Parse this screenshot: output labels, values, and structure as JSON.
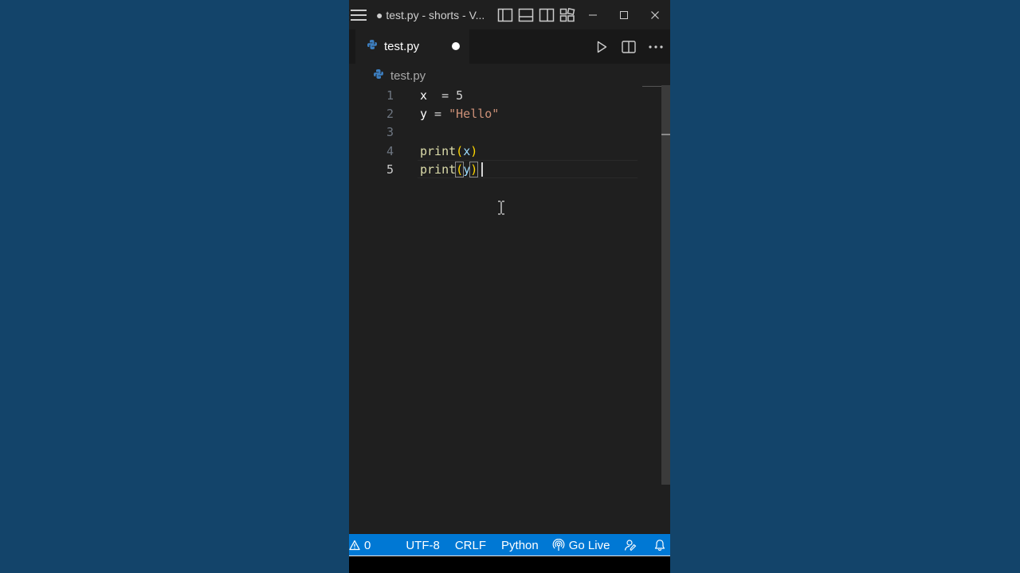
{
  "window": {
    "title": "● test.py - shorts - V..."
  },
  "tabs": [
    {
      "label": "test.py",
      "dirty": true
    }
  ],
  "breadcrumb": {
    "file": "test.py"
  },
  "editor": {
    "lines": [
      {
        "number": "1",
        "text": "x  = 5"
      },
      {
        "number": "2",
        "text": "y = \"Hello\""
      },
      {
        "number": "3",
        "text": ""
      },
      {
        "number": "4",
        "text": "print(x)"
      },
      {
        "number": "5",
        "text": "print(y)"
      }
    ],
    "active_line": "5"
  },
  "statusbar": {
    "problems_count": "0",
    "encoding": "UTF-8",
    "line_ending": "CRLF",
    "language": "Python",
    "go_live": "Go Live"
  },
  "colors": {
    "statusbar_bg": "#0078d4",
    "editor_bg": "#1f1f1f",
    "desktop_bg": "#13446a",
    "string": "#ce9178",
    "function": "#dcdcaa",
    "bracket": "#ffd700"
  },
  "icons": {
    "menu": "hamburger-icon",
    "layout": [
      "toggle-primary-sidebar-icon",
      "toggle-panel-icon",
      "toggle-secondary-sidebar-icon",
      "customize-layout-icon"
    ],
    "window": [
      "minimize-icon",
      "maximize-icon",
      "close-icon"
    ],
    "editor_actions": [
      "run-icon",
      "split-editor-icon",
      "more-actions-icon"
    ],
    "status": [
      "warning-icon",
      "broadcast-icon",
      "accounts-icon",
      "bell-icon"
    ]
  }
}
